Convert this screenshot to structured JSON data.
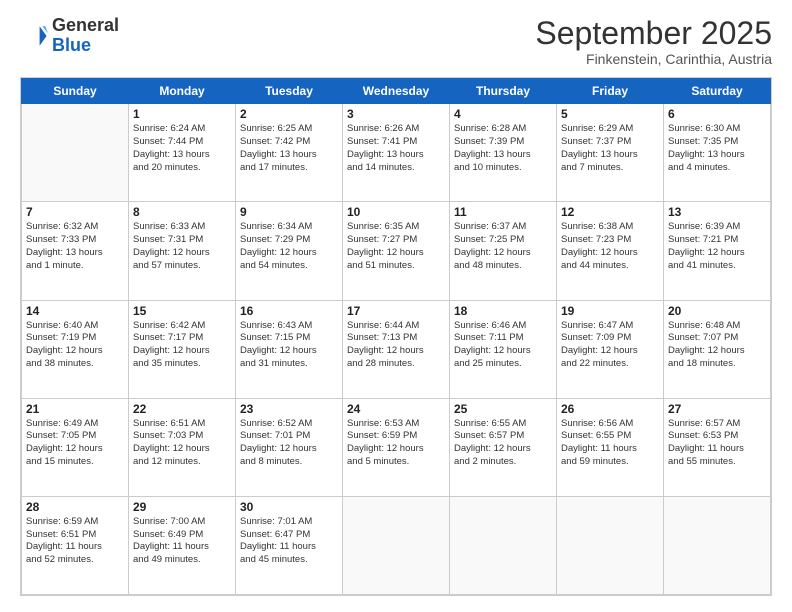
{
  "logo": {
    "general": "General",
    "blue": "Blue"
  },
  "header": {
    "month": "September 2025",
    "location": "Finkenstein, Carinthia, Austria"
  },
  "days": [
    "Sunday",
    "Monday",
    "Tuesday",
    "Wednesday",
    "Thursday",
    "Friday",
    "Saturday"
  ],
  "weeks": [
    [
      {
        "num": "",
        "lines": []
      },
      {
        "num": "1",
        "lines": [
          "Sunrise: 6:24 AM",
          "Sunset: 7:44 PM",
          "Daylight: 13 hours",
          "and 20 minutes."
        ]
      },
      {
        "num": "2",
        "lines": [
          "Sunrise: 6:25 AM",
          "Sunset: 7:42 PM",
          "Daylight: 13 hours",
          "and 17 minutes."
        ]
      },
      {
        "num": "3",
        "lines": [
          "Sunrise: 6:26 AM",
          "Sunset: 7:41 PM",
          "Daylight: 13 hours",
          "and 14 minutes."
        ]
      },
      {
        "num": "4",
        "lines": [
          "Sunrise: 6:28 AM",
          "Sunset: 7:39 PM",
          "Daylight: 13 hours",
          "and 10 minutes."
        ]
      },
      {
        "num": "5",
        "lines": [
          "Sunrise: 6:29 AM",
          "Sunset: 7:37 PM",
          "Daylight: 13 hours",
          "and 7 minutes."
        ]
      },
      {
        "num": "6",
        "lines": [
          "Sunrise: 6:30 AM",
          "Sunset: 7:35 PM",
          "Daylight: 13 hours",
          "and 4 minutes."
        ]
      }
    ],
    [
      {
        "num": "7",
        "lines": [
          "Sunrise: 6:32 AM",
          "Sunset: 7:33 PM",
          "Daylight: 13 hours",
          "and 1 minute."
        ]
      },
      {
        "num": "8",
        "lines": [
          "Sunrise: 6:33 AM",
          "Sunset: 7:31 PM",
          "Daylight: 12 hours",
          "and 57 minutes."
        ]
      },
      {
        "num": "9",
        "lines": [
          "Sunrise: 6:34 AM",
          "Sunset: 7:29 PM",
          "Daylight: 12 hours",
          "and 54 minutes."
        ]
      },
      {
        "num": "10",
        "lines": [
          "Sunrise: 6:35 AM",
          "Sunset: 7:27 PM",
          "Daylight: 12 hours",
          "and 51 minutes."
        ]
      },
      {
        "num": "11",
        "lines": [
          "Sunrise: 6:37 AM",
          "Sunset: 7:25 PM",
          "Daylight: 12 hours",
          "and 48 minutes."
        ]
      },
      {
        "num": "12",
        "lines": [
          "Sunrise: 6:38 AM",
          "Sunset: 7:23 PM",
          "Daylight: 12 hours",
          "and 44 minutes."
        ]
      },
      {
        "num": "13",
        "lines": [
          "Sunrise: 6:39 AM",
          "Sunset: 7:21 PM",
          "Daylight: 12 hours",
          "and 41 minutes."
        ]
      }
    ],
    [
      {
        "num": "14",
        "lines": [
          "Sunrise: 6:40 AM",
          "Sunset: 7:19 PM",
          "Daylight: 12 hours",
          "and 38 minutes."
        ]
      },
      {
        "num": "15",
        "lines": [
          "Sunrise: 6:42 AM",
          "Sunset: 7:17 PM",
          "Daylight: 12 hours",
          "and 35 minutes."
        ]
      },
      {
        "num": "16",
        "lines": [
          "Sunrise: 6:43 AM",
          "Sunset: 7:15 PM",
          "Daylight: 12 hours",
          "and 31 minutes."
        ]
      },
      {
        "num": "17",
        "lines": [
          "Sunrise: 6:44 AM",
          "Sunset: 7:13 PM",
          "Daylight: 12 hours",
          "and 28 minutes."
        ]
      },
      {
        "num": "18",
        "lines": [
          "Sunrise: 6:46 AM",
          "Sunset: 7:11 PM",
          "Daylight: 12 hours",
          "and 25 minutes."
        ]
      },
      {
        "num": "19",
        "lines": [
          "Sunrise: 6:47 AM",
          "Sunset: 7:09 PM",
          "Daylight: 12 hours",
          "and 22 minutes."
        ]
      },
      {
        "num": "20",
        "lines": [
          "Sunrise: 6:48 AM",
          "Sunset: 7:07 PM",
          "Daylight: 12 hours",
          "and 18 minutes."
        ]
      }
    ],
    [
      {
        "num": "21",
        "lines": [
          "Sunrise: 6:49 AM",
          "Sunset: 7:05 PM",
          "Daylight: 12 hours",
          "and 15 minutes."
        ]
      },
      {
        "num": "22",
        "lines": [
          "Sunrise: 6:51 AM",
          "Sunset: 7:03 PM",
          "Daylight: 12 hours",
          "and 12 minutes."
        ]
      },
      {
        "num": "23",
        "lines": [
          "Sunrise: 6:52 AM",
          "Sunset: 7:01 PM",
          "Daylight: 12 hours",
          "and 8 minutes."
        ]
      },
      {
        "num": "24",
        "lines": [
          "Sunrise: 6:53 AM",
          "Sunset: 6:59 PM",
          "Daylight: 12 hours",
          "and 5 minutes."
        ]
      },
      {
        "num": "25",
        "lines": [
          "Sunrise: 6:55 AM",
          "Sunset: 6:57 PM",
          "Daylight: 12 hours",
          "and 2 minutes."
        ]
      },
      {
        "num": "26",
        "lines": [
          "Sunrise: 6:56 AM",
          "Sunset: 6:55 PM",
          "Daylight: 11 hours",
          "and 59 minutes."
        ]
      },
      {
        "num": "27",
        "lines": [
          "Sunrise: 6:57 AM",
          "Sunset: 6:53 PM",
          "Daylight: 11 hours",
          "and 55 minutes."
        ]
      }
    ],
    [
      {
        "num": "28",
        "lines": [
          "Sunrise: 6:59 AM",
          "Sunset: 6:51 PM",
          "Daylight: 11 hours",
          "and 52 minutes."
        ]
      },
      {
        "num": "29",
        "lines": [
          "Sunrise: 7:00 AM",
          "Sunset: 6:49 PM",
          "Daylight: 11 hours",
          "and 49 minutes."
        ]
      },
      {
        "num": "30",
        "lines": [
          "Sunrise: 7:01 AM",
          "Sunset: 6:47 PM",
          "Daylight: 11 hours",
          "and 45 minutes."
        ]
      },
      {
        "num": "",
        "lines": []
      },
      {
        "num": "",
        "lines": []
      },
      {
        "num": "",
        "lines": []
      },
      {
        "num": "",
        "lines": []
      }
    ]
  ]
}
